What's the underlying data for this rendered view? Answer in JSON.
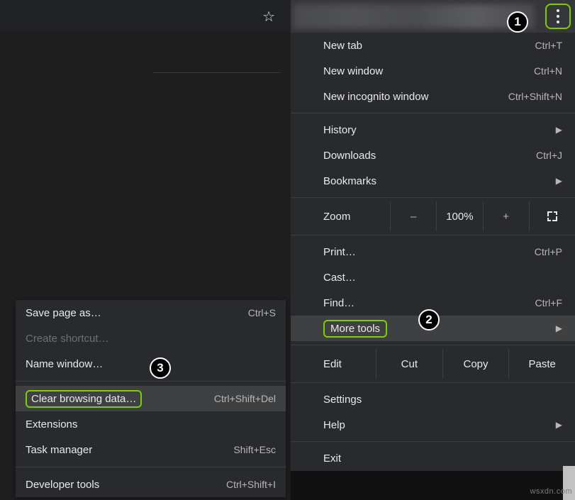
{
  "omnibox": {
    "star_icon": "☆"
  },
  "toolbar": {
    "kebab": "⋮"
  },
  "badges": {
    "b1": "1",
    "b2": "2",
    "b3": "3"
  },
  "menu": {
    "new_tab": {
      "label": "New tab",
      "shortcut": "Ctrl+T"
    },
    "new_window": {
      "label": "New window",
      "shortcut": "Ctrl+N"
    },
    "new_incognito": {
      "label": "New incognito window",
      "shortcut": "Ctrl+Shift+N"
    },
    "history": {
      "label": "History",
      "chev": "▶"
    },
    "downloads": {
      "label": "Downloads",
      "shortcut": "Ctrl+J"
    },
    "bookmarks": {
      "label": "Bookmarks",
      "chev": "▶"
    },
    "zoom": {
      "label": "Zoom",
      "minus": "–",
      "value": "100%",
      "plus": "+"
    },
    "print": {
      "label": "Print…",
      "shortcut": "Ctrl+P"
    },
    "cast": {
      "label": "Cast…"
    },
    "find": {
      "label": "Find…",
      "shortcut": "Ctrl+F"
    },
    "more_tools": {
      "label": "More tools",
      "chev": "▶"
    },
    "edit": {
      "label": "Edit",
      "cut": "Cut",
      "copy": "Copy",
      "paste": "Paste"
    },
    "settings": {
      "label": "Settings"
    },
    "help": {
      "label": "Help",
      "chev": "▶"
    },
    "exit": {
      "label": "Exit"
    }
  },
  "submenu": {
    "save_page": {
      "label": "Save page as…",
      "shortcut": "Ctrl+S"
    },
    "create_shortcut": {
      "label": "Create shortcut…"
    },
    "name_window": {
      "label": "Name window…"
    },
    "clear_data": {
      "label": "Clear browsing data…",
      "shortcut": "Ctrl+Shift+Del"
    },
    "extensions": {
      "label": "Extensions"
    },
    "task_manager": {
      "label": "Task manager",
      "shortcut": "Shift+Esc"
    },
    "dev_tools": {
      "label": "Developer tools",
      "shortcut": "Ctrl+Shift+I"
    }
  },
  "watermark": "wsxdn.com"
}
